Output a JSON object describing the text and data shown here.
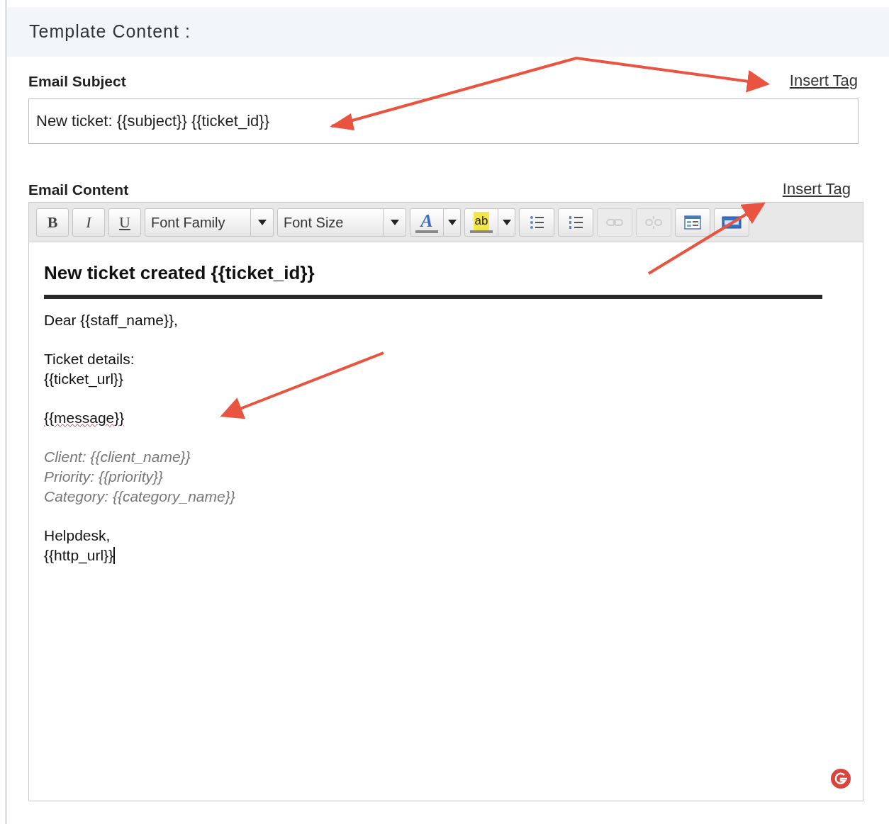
{
  "section": {
    "title": "Template Content :"
  },
  "subject": {
    "label": "Email Subject",
    "insert_tag": "Insert Tag",
    "value": "New ticket: {{subject}} {{ticket_id}}"
  },
  "content": {
    "label": "Email Content",
    "insert_tag": "Insert Tag"
  },
  "toolbar": [
    {
      "kind": "bold",
      "label": "B",
      "disabled": false
    },
    {
      "kind": "italic",
      "label": "I",
      "disabled": false
    },
    {
      "kind": "underline",
      "label": "U",
      "disabled": false
    },
    {
      "kind": "select",
      "label": "Font Family",
      "disabled": false
    },
    {
      "kind": "select",
      "label": "Font Size",
      "disabled": false
    },
    {
      "kind": "fontcolor",
      "label": "A",
      "disabled": false
    },
    {
      "kind": "highlight",
      "label": "ab",
      "disabled": false
    },
    {
      "kind": "bullets",
      "disabled": false
    },
    {
      "kind": "numbers",
      "disabled": false
    },
    {
      "kind": "link",
      "disabled": true
    },
    {
      "kind": "unlink",
      "disabled": true
    },
    {
      "kind": "table",
      "disabled": false
    },
    {
      "kind": "html",
      "disabled": false
    }
  ],
  "body": [
    {
      "kind": "heading",
      "text": "New ticket created {{ticket_id}}"
    },
    {
      "kind": "rule"
    },
    {
      "kind": "line",
      "text": "Dear {{staff_name}},"
    },
    {
      "kind": "gap"
    },
    {
      "kind": "line",
      "text": "Ticket details:"
    },
    {
      "kind": "line",
      "text": "{{ticket_url}}"
    },
    {
      "kind": "gap"
    },
    {
      "kind": "line",
      "text": "{{message}}",
      "misspelled": true
    },
    {
      "kind": "gap"
    },
    {
      "kind": "note",
      "text": "Client: {{client_name}}"
    },
    {
      "kind": "note",
      "text": "Priority: {{priority}}"
    },
    {
      "kind": "note",
      "text": "Category: {{category_name}}"
    },
    {
      "kind": "gap"
    },
    {
      "kind": "line",
      "text": "Helpdesk,"
    },
    {
      "kind": "line",
      "text": "{{http_url}}",
      "cursor": true
    }
  ]
}
